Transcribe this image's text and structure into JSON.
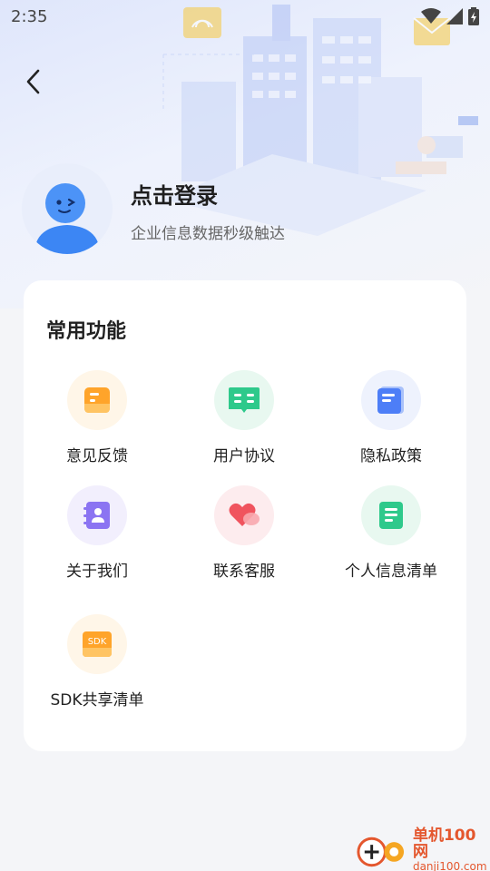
{
  "status": {
    "time": "2:35"
  },
  "header": {
    "title": "点击登录",
    "subtitle": "企业信息数据秒级触达"
  },
  "section": {
    "title": "常用功能",
    "items": [
      {
        "label": "意见反馈",
        "icon": "feedback-icon",
        "color": "#ffa42a",
        "bg": "#fff6e8"
      },
      {
        "label": "用户协议",
        "icon": "book-icon",
        "color": "#2ec98b",
        "bg": "#e8f8f0"
      },
      {
        "label": "隐私政策",
        "icon": "document-icon",
        "color": "#4d7ef7",
        "bg": "#eef2fd"
      },
      {
        "label": "关于我们",
        "icon": "contact-book-icon",
        "color": "#8b74f2",
        "bg": "#f2effd"
      },
      {
        "label": "联系客服",
        "icon": "heart-chat-icon",
        "color": "#f0545e",
        "bg": "#fdecee"
      },
      {
        "label": "个人信息清单",
        "icon": "list-icon",
        "color": "#2ec98b",
        "bg": "#e8f8f0"
      },
      {
        "label": "SDK共享清单",
        "icon": "sdk-icon",
        "color": "#ffa42a",
        "bg": "#fff6e8",
        "badge": "SDK"
      }
    ]
  },
  "watermark": {
    "name": "单机100网",
    "url": "danji100.com"
  }
}
